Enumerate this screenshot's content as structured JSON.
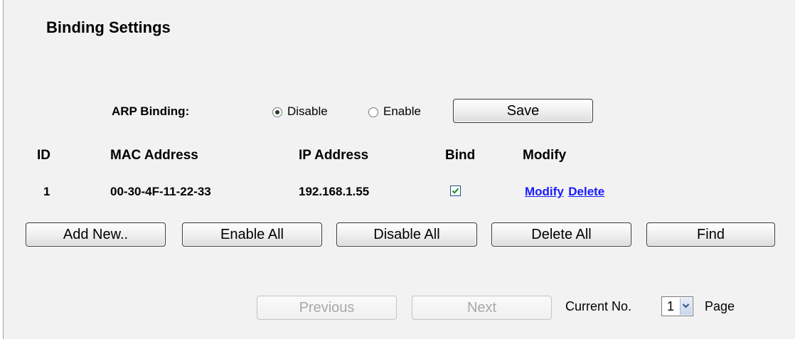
{
  "title": "Binding Settings",
  "arp": {
    "label": "ARP Binding:",
    "options": [
      {
        "label": "Disable",
        "checked": true
      },
      {
        "label": "Enable",
        "checked": false
      }
    ],
    "save_label": "Save"
  },
  "table": {
    "headers": {
      "id": "ID",
      "mac": "MAC Address",
      "ip": "IP Address",
      "bind": "Bind",
      "modify": "Modify"
    },
    "rows": [
      {
        "id": "1",
        "mac": "00-30-4F-11-22-33",
        "ip": "192.168.1.55",
        "bind": true,
        "modify_link": "Modify",
        "delete_link": "Delete"
      }
    ]
  },
  "actions": {
    "add_new": "Add New..",
    "enable_all": "Enable All",
    "disable_all": "Disable All",
    "delete_all": "Delete All",
    "find": "Find"
  },
  "pager": {
    "previous": "Previous",
    "next": "Next",
    "current_label": "Current No.",
    "current_value": "1",
    "page_label": "Page"
  },
  "colors": {
    "link": "#1a1aff",
    "panel_bg": "#f2f2f2",
    "checkmark": "#1e8a1e"
  }
}
